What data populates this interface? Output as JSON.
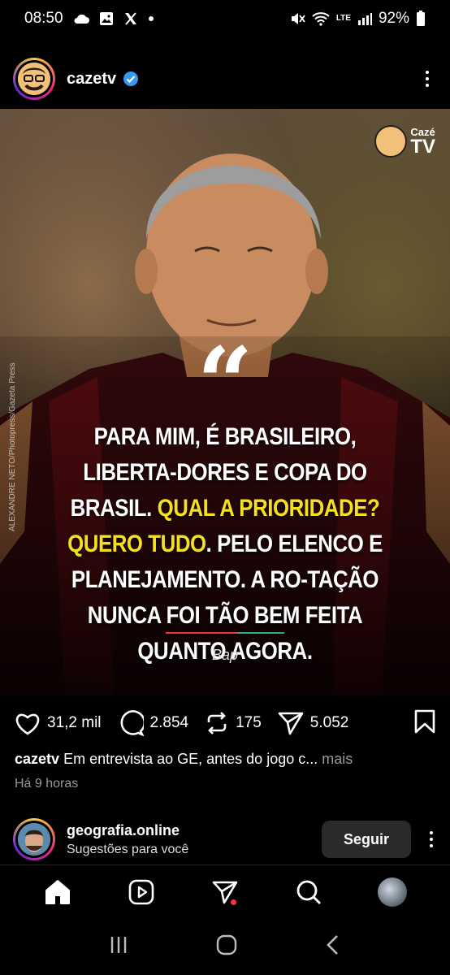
{
  "status_bar": {
    "time": "08:50",
    "battery": "92%",
    "network_label": "LTE"
  },
  "post": {
    "username": "cazetv",
    "image": {
      "brand_small": "Cazé",
      "brand_large": "TV",
      "photo_credit": "ALEXANDRE NETO/Photopress/Gazeta Press",
      "quote_mark": "“",
      "quote_part1": "Para mim, é brasileiro, Liberta-dores e Copa do Brasil. ",
      "quote_highlight": "Qual a prioridade? Quero tudo",
      "quote_part2": ". Pelo elenco e planejamento. A ro-tação nunca foi tão bem feita quanto agora.",
      "author": "Bap"
    },
    "likes": "31,2 mil",
    "comments": "2.854",
    "reposts": "175",
    "shares": "5.052",
    "caption_user": "cazetv",
    "caption_text": "Em entrevista ao GE, antes do jogo c...",
    "caption_more": "mais",
    "time_ago": "Há 9 horas"
  },
  "suggestion": {
    "username": "geografia.online",
    "subtitle": "Sugestões para você",
    "follow_label": "Seguir"
  }
}
